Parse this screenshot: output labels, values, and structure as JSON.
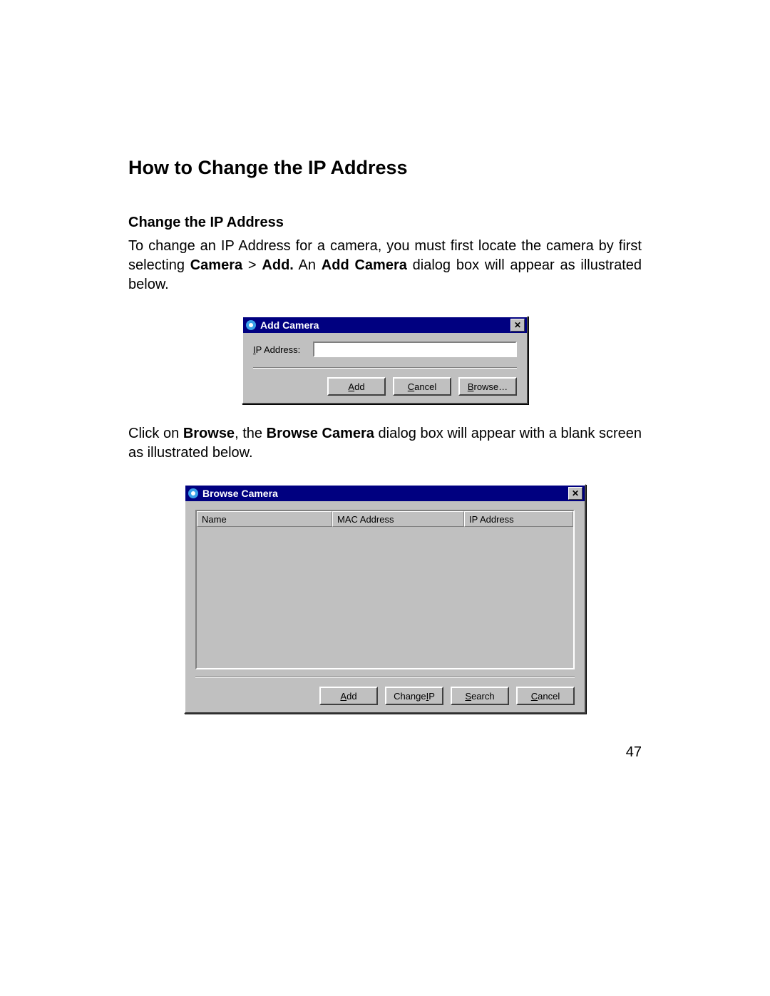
{
  "page": {
    "heading": "How to Change the IP Address",
    "subheading": "Change the IP Address",
    "para1_a": "To change an IP Address for a camera, you must first locate the camera by first selecting ",
    "para1_b": "Camera",
    "para1_c": " > ",
    "para1_d": "Add.",
    "para1_e": "  An ",
    "para1_f": "Add Camera",
    "para1_g": " dialog box will appear as illustrated below.",
    "para2_a": "Click on ",
    "para2_b": "Browse",
    "para2_c": ", the ",
    "para2_d": "Browse Camera",
    "para2_e": " dialog box will appear with a blank screen as illustrated below.",
    "page_number": "47"
  },
  "add_camera_dialog": {
    "title": "Add Camera",
    "ip_label_pre": "I",
    "ip_label_rest": "P Address:",
    "ip_value": "",
    "add_btn_u": "A",
    "add_btn_rest": "dd",
    "cancel_btn_u": "C",
    "cancel_btn_rest": "ancel",
    "browse_btn_u": "B",
    "browse_btn_rest": "rowse…"
  },
  "browse_camera_dialog": {
    "title": "Browse Camera",
    "col_name": "Name",
    "col_mac": "MAC Address",
    "col_ip": "IP Address",
    "add_btn_u": "A",
    "add_btn_rest": "dd",
    "changeip_btn_pre": "Change ",
    "changeip_btn_u": "I",
    "changeip_btn_rest": "P",
    "search_btn_u": "S",
    "search_btn_rest": "earch",
    "cancel_btn_u": "C",
    "cancel_btn_rest": "ancel"
  }
}
